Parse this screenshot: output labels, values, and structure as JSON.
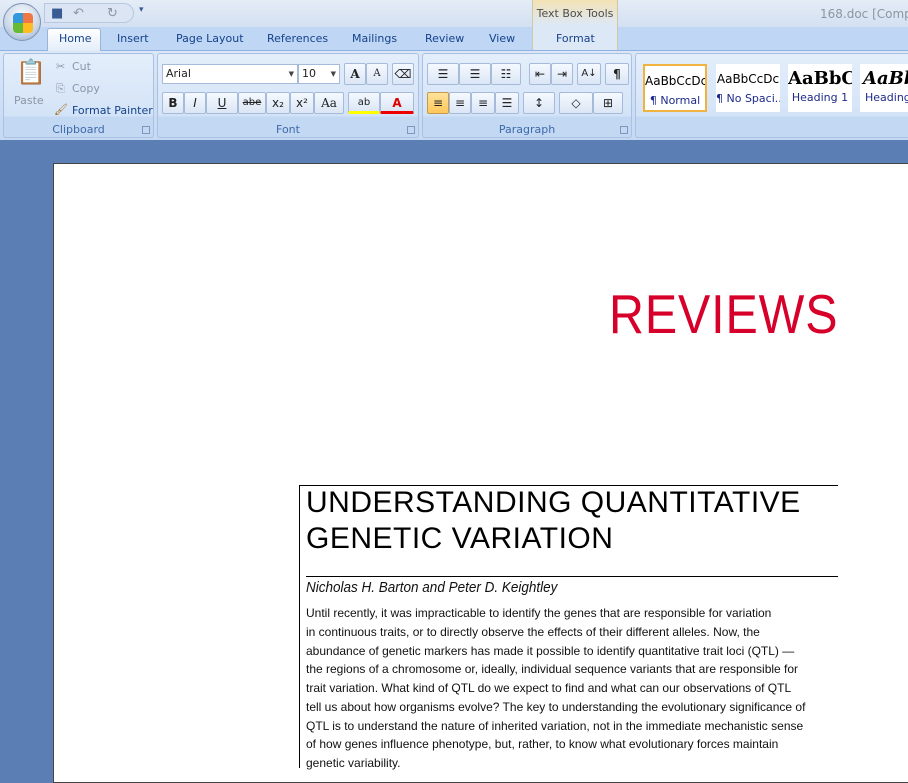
{
  "window": {
    "title": "168.doc [Comp",
    "context_tab_group": "Text Box Tools"
  },
  "tabs": [
    "Home",
    "Insert",
    "Page Layout",
    "References",
    "Mailings",
    "Review",
    "View",
    "Format"
  ],
  "clipboard": {
    "label": "Clipboard",
    "paste": "Paste",
    "cut": "Cut",
    "copy": "Copy",
    "format_painter": "Format Painter"
  },
  "font": {
    "label": "Font",
    "name": "Arial",
    "size": "10",
    "bold": "B",
    "italic": "I",
    "underline": "U",
    "strike": "abe",
    "sub": "x₂",
    "sup": "x²",
    "case": "Aa",
    "grow": "A",
    "shrink": "A",
    "highlight": "ab",
    "color": "A"
  },
  "paragraph": {
    "label": "Paragraph",
    "pilcrow": "¶",
    "sort": "A↓"
  },
  "styles": [
    {
      "preview": "AaBbCcDc",
      "label": "¶ Normal"
    },
    {
      "preview": "AaBbCcDc",
      "label": "¶ No Spaci..."
    },
    {
      "preview": "AaBbC",
      "label": "Heading 1"
    },
    {
      "preview": "AaBb",
      "label": "Heading"
    }
  ],
  "document": {
    "banner": "REVIEWS",
    "title_lines": [
      "UNDERSTANDING QUANTITATIVE",
      "GENETIC VARIATION"
    ],
    "authors": "Nicholas H. Barton  and Peter  D. Keightley",
    "abstract_lines": [
      "Until recently, it was impracticable to identify the genes that are responsible for variation",
      "in continuous traits, or to directly observe the effects of their different alleles.  Now, the",
      "abundance of genetic markers  has made it possible to identify quantitative trait loci (QTL) —",
      "the regions of a chromosome or, ideally, individual  sequence variants that are responsible for",
      "trait variation.  What kind of QTL do we expect to find and what can our observations of QTL",
      "tell us about how organisms evolve?  The key to understanding the evolutionary significance of",
      "QTL is to understand the nature of inherited variation,  not in the immediate mechanistic sense",
      "of how genes influence  phenotype, but, rather,  to know what evolutionary forces maintain",
      "genetic variability."
    ]
  }
}
